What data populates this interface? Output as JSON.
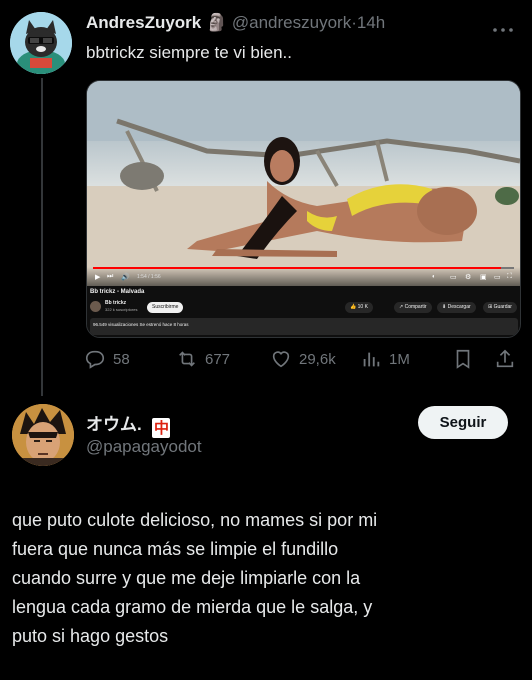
{
  "tweet1": {
    "display_name": "AndresZuyork",
    "name_emoji": "🗿",
    "handle": "@andreszuyork",
    "separator": "·",
    "time": "14h",
    "more_icon": "more-dots-icon",
    "text": "bbtrickz siempre te vi bien..",
    "media": {
      "time_display": "1:54 / 1:56",
      "progress": 0.97,
      "video_title": "Bb trickz - Malvada",
      "channel_name": "Bb trickz",
      "subscribers": "322 k suscriptores",
      "subscribe_label": "Suscribirme",
      "likes": "10 K",
      "share_label": "Compartir",
      "download_label": "Descargar",
      "save_label": "Guardar",
      "description": "96.549 visualizaciones  Se estrenó hace 8 horas"
    },
    "actions": {
      "replies": "58",
      "reposts": "677",
      "likes": "29,6k",
      "views": "1M"
    }
  },
  "tweet2": {
    "display_name": "オウム.",
    "badge": "中",
    "handle": "@papagayodot",
    "follow_label": "Seguir",
    "text_lines": [
      "que puto culote delicioso, no mames si por mi",
      "fuera que nunca más se limpie el fundillo",
      "cuando surre y que me deje limpiarle con la",
      "lengua cada gramo de mierda que le salga, y",
      "puto si hago gestos"
    ]
  },
  "colors": {
    "background": "#000000",
    "text": "#e7e9ea",
    "muted": "#71767b",
    "button_bg": "#eff3f4",
    "progress": "#ff0000"
  }
}
